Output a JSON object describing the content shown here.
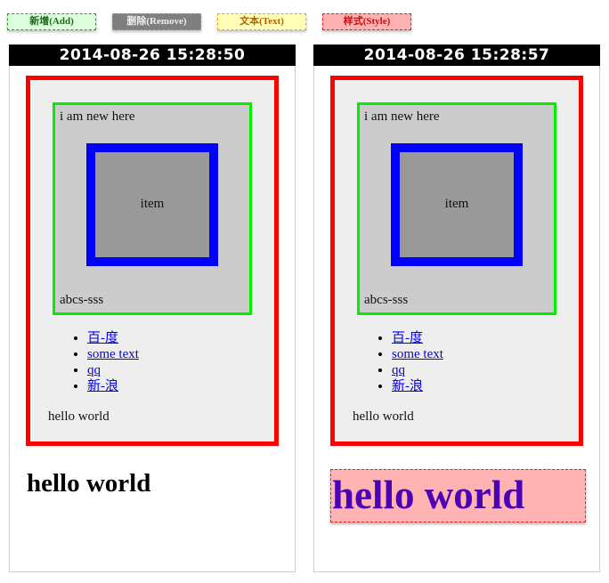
{
  "toolbar": {
    "add_label": "新增(Add)",
    "remove_label": "删除(Remove)",
    "text_label": "文本(Text)",
    "style_label": "样式(Style)"
  },
  "panels": [
    {
      "timestamp": "2014-08-26 15:28:50",
      "new_text": "i am new here",
      "item_text": "item",
      "footer_text": "abcs-sss",
      "links": [
        "百-度",
        "some text",
        "qq",
        "新-浪"
      ],
      "hello_small": "hello world",
      "hello_big": "hello world"
    },
    {
      "timestamp": "2014-08-26 15:28:57",
      "new_text": "i am new here",
      "item_text": "item",
      "footer_text": "abcs-sss",
      "links": [
        "百-度",
        "some text",
        "qq",
        "新-浪"
      ],
      "hello_small": "hello world",
      "hello_big": "hello world"
    }
  ],
  "colors": {
    "outer_border": "#ff0000",
    "green_border": "#00ee00",
    "blue_border": "#0000ff",
    "styled_text": "#4b00b5",
    "styled_bg": "#ffb3b3"
  }
}
